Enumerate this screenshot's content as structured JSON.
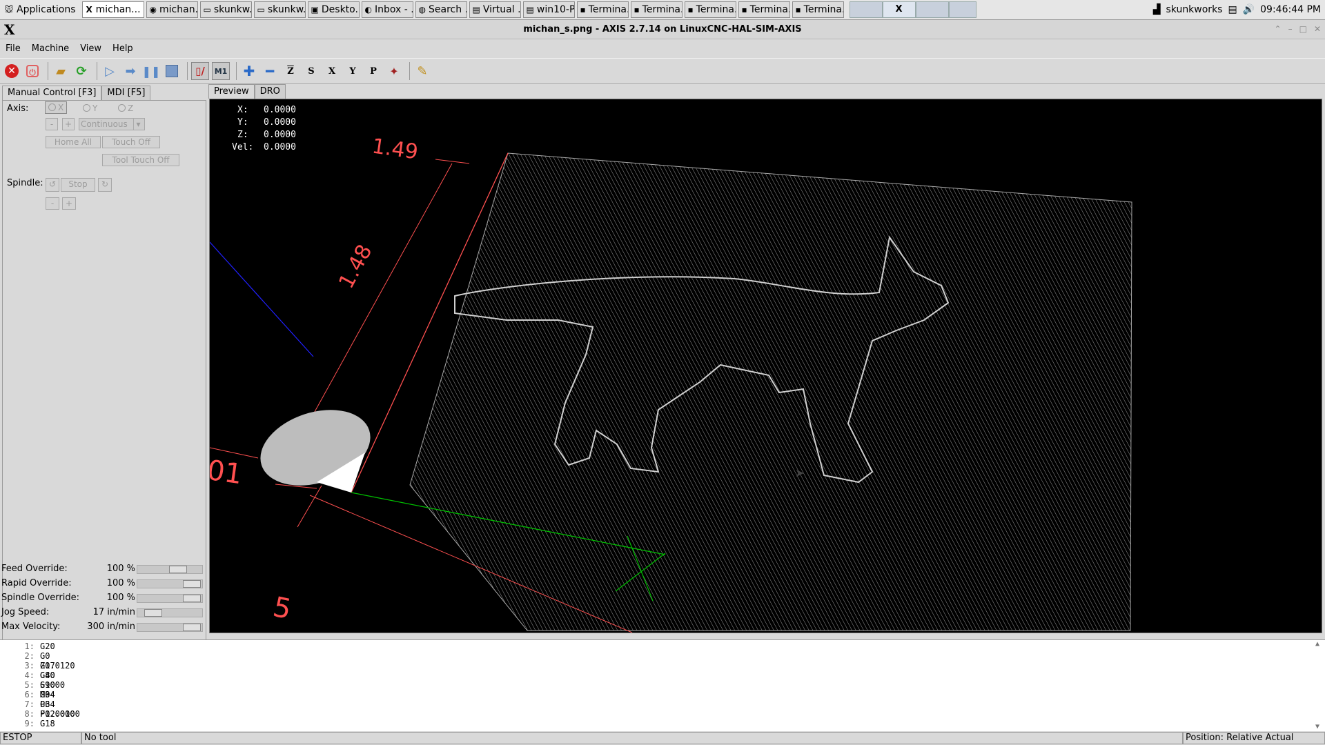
{
  "taskbar": {
    "start_label": "Applications",
    "buttons": [
      {
        "label": "michan...",
        "icon": "x-icon",
        "active": true
      },
      {
        "label": "michan...",
        "icon": "chrome-icon"
      },
      {
        "label": "skunkw...",
        "icon": "folder-icon"
      },
      {
        "label": "skunkw...",
        "icon": "folder-icon"
      },
      {
        "label": "Deskto...",
        "icon": "desktop-icon"
      },
      {
        "label": "Inbox - ...",
        "icon": "thunderbird-icon"
      },
      {
        "label": "Search ...",
        "icon": "firefox-icon"
      },
      {
        "label": "Virtual ...",
        "icon": "vm-icon"
      },
      {
        "label": "win10-P...",
        "icon": "vm-icon"
      },
      {
        "label": "Termina...",
        "icon": "terminal-icon"
      },
      {
        "label": "Termina...",
        "icon": "terminal-icon"
      },
      {
        "label": "Termina...",
        "icon": "terminal-icon"
      },
      {
        "label": "Termina...",
        "icon": "terminal-icon"
      },
      {
        "label": "Termina...",
        "icon": "terminal-icon"
      }
    ],
    "tray_user": "skunkworks",
    "clock": "09:46:44 PM"
  },
  "window": {
    "logo": "X",
    "title": "michan_s.png - AXIS 2.7.14 on LinuxCNC-HAL-SIM-AXIS"
  },
  "menu": [
    "File",
    "Machine",
    "View",
    "Help"
  ],
  "left_tabs": [
    "Manual Control [F3]",
    "MDI [F5]"
  ],
  "manual": {
    "axis_label": "Axis:",
    "axes": [
      "X",
      "Y",
      "Z"
    ],
    "minus": "-",
    "plus": "+",
    "jog_mode": "Continuous",
    "home_all": "Home All",
    "touch_off": "Touch Off",
    "tool_touch_off": "Tool Touch Off",
    "spindle_label": "Spindle:",
    "stop": "Stop"
  },
  "overrides": [
    {
      "name": "Feed Override:",
      "value": "100 %",
      "level": 0.7
    },
    {
      "name": "Rapid Override:",
      "value": "100 %",
      "level": 1.0
    },
    {
      "name": "Spindle Override:",
      "value": "100 %",
      "level": 1.0
    },
    {
      "name": "Jog Speed:",
      "value": "17 in/min",
      "level": 0.15
    },
    {
      "name": "Max Velocity:",
      "value": "300 in/min",
      "level": 1.0
    }
  ],
  "preview_tabs": [
    "Preview",
    "DRO"
  ],
  "dro": [
    {
      "axis": "X:",
      "value": "0.0000"
    },
    {
      "axis": "Y:",
      "value": "0.0000"
    },
    {
      "axis": "Z:",
      "value": "0.0000"
    },
    {
      "axis": "Vel:",
      "value": "0.0000"
    }
  ],
  "dims": {
    "top": "1.49",
    "side": "1.48",
    "left_num": "01",
    "bottom": "5"
  },
  "gcode": [
    {
      "n": "1:",
      "code": "G20"
    },
    {
      "n": "2:",
      "code": "G0 Z0.0120"
    },
    {
      "n": "3:",
      "code": "G17 G40"
    },
    {
      "n": "4:",
      "code": "G80 G90 G94"
    },
    {
      "n": "5:",
      "code": "S1000 M3"
    },
    {
      "n": "6:",
      "code": "G04 P3"
    },
    {
      "n": "7:",
      "code": "G64 P0.0010"
    },
    {
      "n": "8:",
      "code": "F12.0000"
    },
    {
      "n": "9:",
      "code": "G18"
    }
  ],
  "status": {
    "state": "ESTOP",
    "tool": "No tool",
    "position": "Position: Relative Actual"
  },
  "colors": {
    "estop": "#d42020",
    "dim_red": "#ff5050",
    "axis_green": "#00c000",
    "axis_blue": "#2020ff"
  }
}
